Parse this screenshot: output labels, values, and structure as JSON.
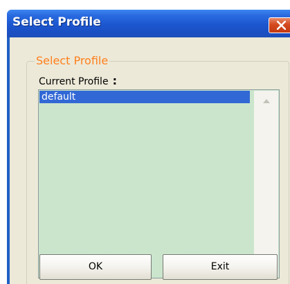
{
  "window": {
    "title": "Select Profile",
    "colors": {
      "titlebar": "#1c56cf",
      "client_background": "#ece9d8",
      "group_legend": "#ff7f1c",
      "listbox_background": "#cbe5cd",
      "selection": "#3168d5",
      "close_button": "#d4491f"
    }
  },
  "group": {
    "legend": "Select Profile",
    "current_profile_label": "Current Profile",
    "colon": ":"
  },
  "profiles": {
    "items": [
      "default"
    ],
    "selected": "default"
  },
  "buttons": {
    "ok_label": "OK",
    "exit_label": "Exit"
  },
  "icons": {
    "close": "close-icon",
    "scroll_up": "chevron-up-icon",
    "scroll_down": "chevron-down-icon"
  }
}
